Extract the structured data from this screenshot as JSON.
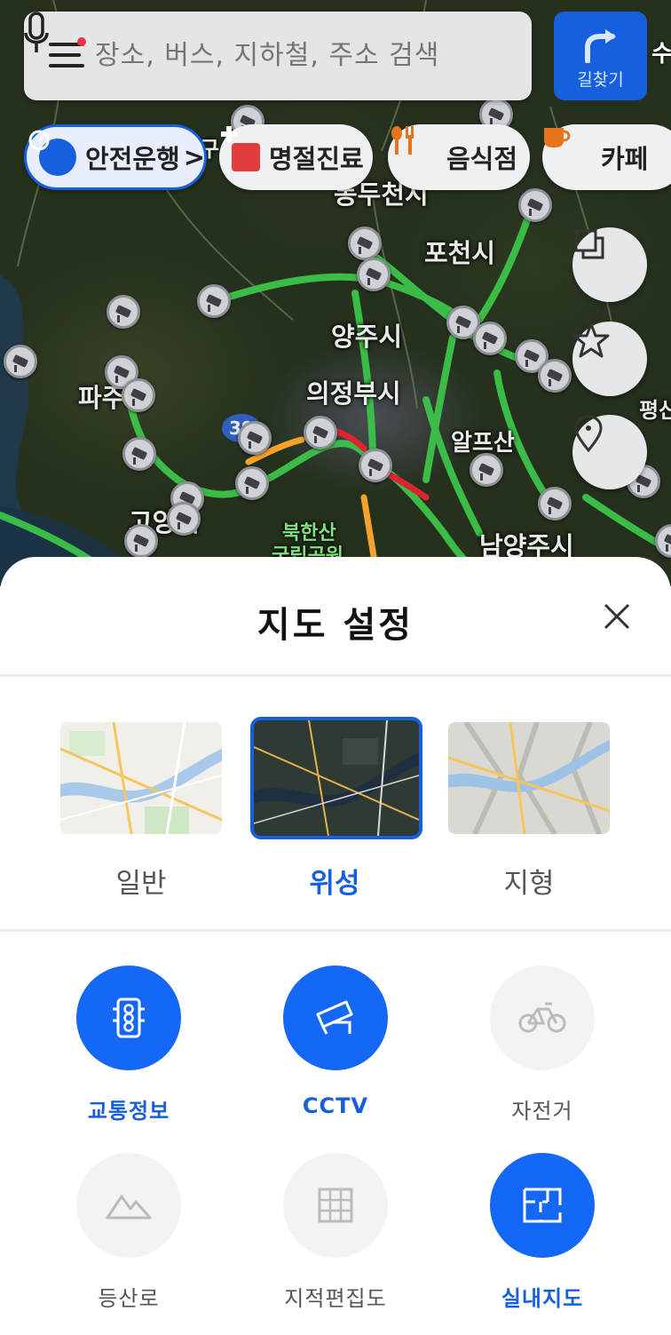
{
  "search": {
    "placeholder": "장소, 버스, 지하철, 주소 검색"
  },
  "route_button": {
    "label": "길찾기"
  },
  "map_edge_text": "수",
  "chips": [
    {
      "label": "안전운행",
      "suffix": ">",
      "icon": "speedometer-icon"
    },
    {
      "label": "명절진료",
      "icon": "medical-cross-icon"
    },
    {
      "label": "음식점",
      "icon": "fork-knife-icon"
    },
    {
      "label": "카페",
      "icon": "coffee-cup-icon"
    }
  ],
  "map_labels": [
    {
      "text": "동두천시"
    },
    {
      "text": "포천시"
    },
    {
      "text": "양주시"
    },
    {
      "text": "의정부시"
    },
    {
      "text": "파주시"
    },
    {
      "text": "고양시"
    },
    {
      "text": "북한산"
    },
    {
      "text": "국립공원"
    },
    {
      "text": "남양주시"
    },
    {
      "text": "알프산"
    },
    {
      "text": "평산"
    },
    {
      "text": "구"
    },
    {
      "text": "39"
    }
  ],
  "sheet": {
    "title": "지도 설정",
    "map_types": [
      {
        "label": "일반",
        "selected": false
      },
      {
        "label": "위성",
        "selected": true
      },
      {
        "label": "지형",
        "selected": false
      }
    ],
    "layers": [
      {
        "label": "교통정보",
        "on": true,
        "icon": "traffic-light-icon"
      },
      {
        "label": "CCTV",
        "on": true,
        "icon": "cctv-camera-icon"
      },
      {
        "label": "자전거",
        "on": false,
        "icon": "bicycle-icon"
      },
      {
        "label": "등산로",
        "on": false,
        "icon": "mountain-icon"
      },
      {
        "label": "지적편집도",
        "on": false,
        "icon": "grid-icon"
      },
      {
        "label": "실내지도",
        "on": true,
        "icon": "floorplan-icon"
      }
    ]
  },
  "colors": {
    "accent": "#1660df",
    "layer_on": "#1568f5",
    "traffic_green": "#3cc44a",
    "traffic_red": "#e0242f",
    "traffic_orange": "#f3a32a"
  }
}
